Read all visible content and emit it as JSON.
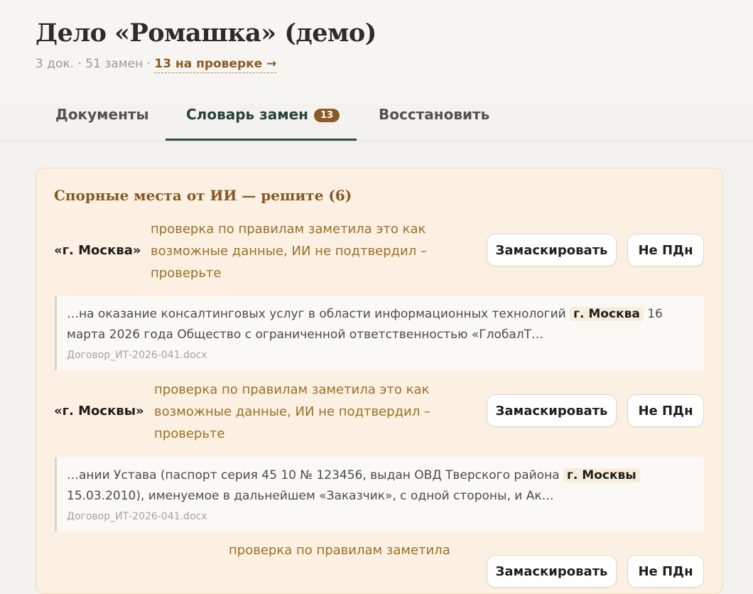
{
  "header": {
    "title": "Дело «Ромашка» (демо)",
    "meta_prefix": "3 док. · 51 замен · ",
    "review_link": "13 на проверке →"
  },
  "tabs": [
    {
      "label": "Документы",
      "active": false
    },
    {
      "label": "Словарь замен",
      "badge": "13",
      "active": true
    },
    {
      "label": "Восстановить",
      "active": false
    }
  ],
  "disputes": {
    "title": "Спорные места от ИИ — решите (6)",
    "mask_label": "Замаскировать",
    "not_pii_label": "Не ПДн",
    "items": [
      {
        "term": "«г. Москва»",
        "note_lines": [
          "проверка по правилам заметила это как",
          "возможные данные, ИИ не подтвердил –",
          "проверьте"
        ],
        "context_before": "…на оказание консалтинговых услуг в области информационных технологий ",
        "context_highlight": "г. Москва",
        "context_after": " 16 марта 2026 года Общество с ограниченной ответственностью «ГлобалТ…",
        "file": "Договор_ИТ-2026-041.docx"
      },
      {
        "term": "«г. Москвы»",
        "note_lines": [
          "проверка по правилам заметила это как",
          "возможные данные, ИИ не подтвердил –",
          "проверьте"
        ],
        "context_before": "…ании Устава (паспорт серия 45 10 № 123456, выдан ОВД Тверского района ",
        "context_highlight": "г. Москвы",
        "context_after": " 15.03.2010), именуемое в дальнейшем «Заказчик», с одной стороны, и Ак…",
        "file": "Договор_ИТ-2026-041.docx"
      },
      {
        "term": "",
        "note_lines": [
          "проверка по правилам заметила"
        ]
      }
    ]
  },
  "colors": {
    "accent_brown": "#8c5a26",
    "active_tab": "#2f5247",
    "panel_bg": "#fcf0e2"
  }
}
